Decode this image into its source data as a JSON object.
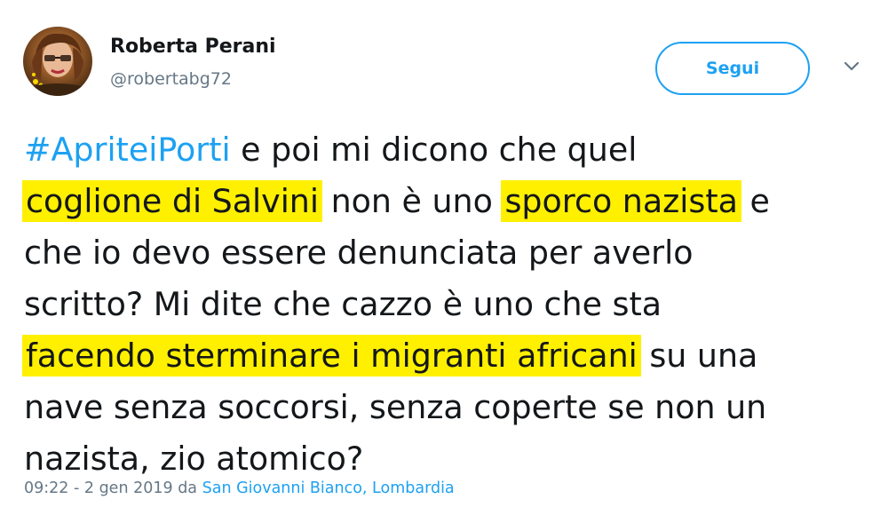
{
  "user": {
    "display_name": "Roberta Perani",
    "handle": "@robertabg72"
  },
  "follow_button": {
    "label": "Segui"
  },
  "caret_icon": "chevron-down-icon",
  "tweet": {
    "hashtag": "#ApriteiPorti",
    "segments": {
      "s1": " e poi mi dicono che quel",
      "h1": "coglione di Salvini",
      "s2": " non è uno ",
      "h2": "sporco nazista",
      "s3": " e",
      "s4": "che io devo essere denunciata per averlo",
      "s5": "scritto? Mi dite che cazzo è uno che sta",
      "h3": "facendo sterminare i migranti africani",
      "s6": " su una",
      "s7": "nave senza soccorsi, senza coperte se non un",
      "s8": "nazista, zio atomico?"
    }
  },
  "meta": {
    "timestamp": "09:22 - 2 gen 2019",
    "via": " da ",
    "location": "San Giovanni Bianco, Lombardia"
  },
  "colors": {
    "accent": "#1da1f2",
    "highlight": "#fff000",
    "muted": "#657786",
    "text": "#14171a"
  }
}
